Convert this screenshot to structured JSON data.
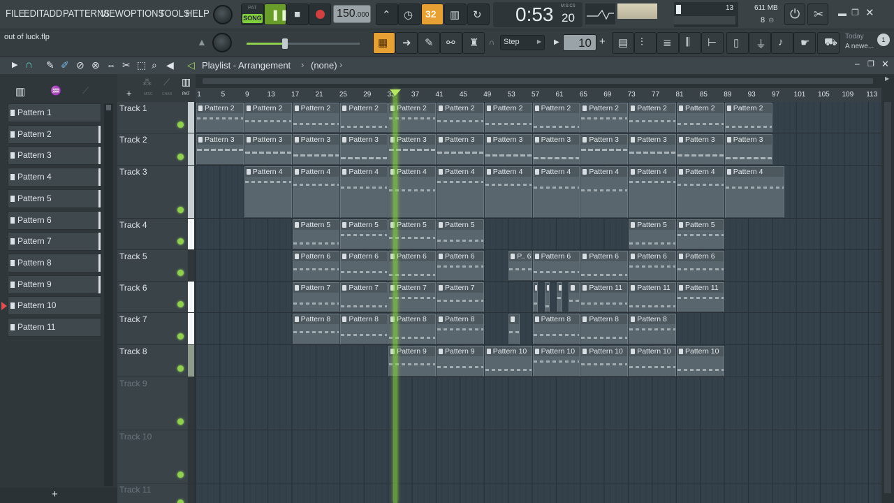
{
  "menu": [
    "FILE",
    "EDIT",
    "ADD",
    "PATTERNS",
    "VIEW",
    "OPTIONS",
    "TOOLS",
    "HELP"
  ],
  "transport": {
    "pat_label": "PAT",
    "song_label": "SONG",
    "tempo": "150",
    "tempo_dec": ".000",
    "time": "0:53",
    "time_sub": "20",
    "time_unit": "M:S:CS",
    "cpu_count": "13",
    "ram": "611 MB",
    "voices": "8",
    "step_label": "Step",
    "snap_value": "10",
    "snap_plus": "+",
    "snap_minus": "−",
    "pattern_num": "32"
  },
  "project": {
    "filename": "out of luck.flp"
  },
  "hint": {
    "date": "Today",
    "text": "A newe..."
  },
  "notification": {
    "count": "1"
  },
  "playlist": {
    "title": "Playlist - Arrangement",
    "pattern": "(none)",
    "sep": "›",
    "modes": [
      "MISC",
      "CHAN",
      "PAT"
    ]
  },
  "ruler": [
    "1",
    "5",
    "9",
    "13",
    "17",
    "21",
    "25",
    "29",
    "33",
    "37",
    "41",
    "45",
    "49",
    "53",
    "57",
    "61",
    "65",
    "69",
    "73",
    "77",
    "81",
    "85",
    "89",
    "93",
    "97",
    "101",
    "105",
    "109",
    "113"
  ],
  "patterns": [
    "Pattern 1",
    "Pattern 2",
    "Pattern 3",
    "Pattern 4",
    "Pattern 5",
    "Pattern 6",
    "Pattern 7",
    "Pattern 8",
    "Pattern 9",
    "Pattern 10",
    "Pattern 11"
  ],
  "tracks": [
    "Track 1",
    "Track 2",
    "Track 3",
    "Track 4",
    "Track 5",
    "Track 6",
    "Track 7",
    "Track 8",
    "Track 9",
    "Track 10",
    "Track 11"
  ],
  "browser_add": "+",
  "clips": [
    {
      "track": 0,
      "bar": 1,
      "len": 8,
      "label": "Pattern 2"
    },
    {
      "track": 0,
      "bar": 9,
      "len": 8,
      "label": "Pattern 2"
    },
    {
      "track": 0,
      "bar": 17,
      "len": 8,
      "label": "Pattern 2"
    },
    {
      "track": 0,
      "bar": 25,
      "len": 8,
      "label": "Pattern 2"
    },
    {
      "track": 0,
      "bar": 33,
      "len": 8,
      "label": "Pattern 2"
    },
    {
      "track": 0,
      "bar": 41,
      "len": 8,
      "label": "Pattern 2"
    },
    {
      "track": 0,
      "bar": 49,
      "len": 8,
      "label": "Pattern 2"
    },
    {
      "track": 0,
      "bar": 57,
      "len": 8,
      "label": "Pattern 2"
    },
    {
      "track": 0,
      "bar": 65,
      "len": 8,
      "label": "Pattern 2"
    },
    {
      "track": 0,
      "bar": 73,
      "len": 8,
      "label": "Pattern 2"
    },
    {
      "track": 0,
      "bar": 81,
      "len": 8,
      "label": "Pattern 2"
    },
    {
      "track": 0,
      "bar": 89,
      "len": 8,
      "label": "Pattern 2"
    },
    {
      "track": 1,
      "bar": 1,
      "len": 8,
      "label": "Pattern 3"
    },
    {
      "track": 1,
      "bar": 9,
      "len": 8,
      "label": "Pattern 3"
    },
    {
      "track": 1,
      "bar": 17,
      "len": 8,
      "label": "Pattern 3"
    },
    {
      "track": 1,
      "bar": 25,
      "len": 8,
      "label": "Pattern 3"
    },
    {
      "track": 1,
      "bar": 33,
      "len": 8,
      "label": "Pattern 3"
    },
    {
      "track": 1,
      "bar": 41,
      "len": 8,
      "label": "Pattern 3"
    },
    {
      "track": 1,
      "bar": 49,
      "len": 8,
      "label": "Pattern 3"
    },
    {
      "track": 1,
      "bar": 57,
      "len": 8,
      "label": "Pattern 3"
    },
    {
      "track": 1,
      "bar": 65,
      "len": 8,
      "label": "Pattern 3"
    },
    {
      "track": 1,
      "bar": 73,
      "len": 8,
      "label": "Pattern 3"
    },
    {
      "track": 1,
      "bar": 81,
      "len": 8,
      "label": "Pattern 3"
    },
    {
      "track": 1,
      "bar": 89,
      "len": 8,
      "label": "Pattern 3"
    },
    {
      "track": 2,
      "bar": 9,
      "len": 8,
      "label": "Pattern 4"
    },
    {
      "track": 2,
      "bar": 17,
      "len": 8,
      "label": "Pattern 4"
    },
    {
      "track": 2,
      "bar": 25,
      "len": 8,
      "label": "Pattern 4"
    },
    {
      "track": 2,
      "bar": 33,
      "len": 8,
      "label": "Pattern 4"
    },
    {
      "track": 2,
      "bar": 41,
      "len": 8,
      "label": "Pattern 4"
    },
    {
      "track": 2,
      "bar": 49,
      "len": 8,
      "label": "Pattern 4"
    },
    {
      "track": 2,
      "bar": 57,
      "len": 8,
      "label": "Pattern 4"
    },
    {
      "track": 2,
      "bar": 65,
      "len": 8,
      "label": "Pattern 4"
    },
    {
      "track": 2,
      "bar": 73,
      "len": 8,
      "label": "Pattern 4"
    },
    {
      "track": 2,
      "bar": 81,
      "len": 8,
      "label": "Pattern 4"
    },
    {
      "track": 2,
      "bar": 89,
      "len": 10,
      "label": "Pattern 4"
    },
    {
      "track": 3,
      "bar": 17,
      "len": 8,
      "label": "Pattern 5"
    },
    {
      "track": 3,
      "bar": 25,
      "len": 8,
      "label": "Pattern 5"
    },
    {
      "track": 3,
      "bar": 33,
      "len": 8,
      "label": "Pattern 5"
    },
    {
      "track": 3,
      "bar": 41,
      "len": 8,
      "label": "Pattern 5"
    },
    {
      "track": 3,
      "bar": 73,
      "len": 8,
      "label": "Pattern 5"
    },
    {
      "track": 3,
      "bar": 81,
      "len": 8,
      "label": "Pattern 5"
    },
    {
      "track": 4,
      "bar": 17,
      "len": 8,
      "label": "Pattern 6"
    },
    {
      "track": 4,
      "bar": 25,
      "len": 8,
      "label": "Pattern 6"
    },
    {
      "track": 4,
      "bar": 33,
      "len": 8,
      "label": "Pattern 6"
    },
    {
      "track": 4,
      "bar": 41,
      "len": 8,
      "label": "Pattern 6"
    },
    {
      "track": 4,
      "bar": 53,
      "len": 4,
      "label": "P.. 6"
    },
    {
      "track": 4,
      "bar": 57,
      "len": 8,
      "label": "Pattern 6"
    },
    {
      "track": 4,
      "bar": 65,
      "len": 8,
      "label": "Pattern 6"
    },
    {
      "track": 4,
      "bar": 73,
      "len": 8,
      "label": "Pattern 6"
    },
    {
      "track": 4,
      "bar": 81,
      "len": 8,
      "label": "Pattern 6"
    },
    {
      "track": 5,
      "bar": 17,
      "len": 8,
      "label": "Pattern 7"
    },
    {
      "track": 5,
      "bar": 25,
      "len": 8,
      "label": "Pattern 7"
    },
    {
      "track": 5,
      "bar": 33,
      "len": 8,
      "label": "Pattern 7"
    },
    {
      "track": 5,
      "bar": 41,
      "len": 8,
      "label": "Pattern 7"
    },
    {
      "track": 5,
      "bar": 57,
      "len": 1,
      "label": ""
    },
    {
      "track": 5,
      "bar": 59,
      "len": 1,
      "label": ""
    },
    {
      "track": 5,
      "bar": 61,
      "len": 1,
      "label": ""
    },
    {
      "track": 5,
      "bar": 63,
      "len": 2,
      "label": ""
    },
    {
      "track": 5,
      "bar": 65,
      "len": 8,
      "label": "Pattern 11"
    },
    {
      "track": 5,
      "bar": 73,
      "len": 8,
      "label": "Pattern 11"
    },
    {
      "track": 5,
      "bar": 81,
      "len": 8,
      "label": "Pattern 11"
    },
    {
      "track": 6,
      "bar": 17,
      "len": 8,
      "label": "Pattern 8"
    },
    {
      "track": 6,
      "bar": 25,
      "len": 8,
      "label": "Pattern 8"
    },
    {
      "track": 6,
      "bar": 33,
      "len": 8,
      "label": "Pattern 8"
    },
    {
      "track": 6,
      "bar": 41,
      "len": 8,
      "label": "Pattern 8"
    },
    {
      "track": 6,
      "bar": 53,
      "len": 2,
      "label": ""
    },
    {
      "track": 6,
      "bar": 57,
      "len": 8,
      "label": "Pattern 8"
    },
    {
      "track": 6,
      "bar": 65,
      "len": 8,
      "label": "Pattern 8"
    },
    {
      "track": 6,
      "bar": 73,
      "len": 8,
      "label": "Pattern 8"
    },
    {
      "track": 7,
      "bar": 33,
      "len": 8,
      "label": "Pattern 9"
    },
    {
      "track": 7,
      "bar": 41,
      "len": 8,
      "label": "Pattern 9"
    },
    {
      "track": 7,
      "bar": 49,
      "len": 8,
      "label": "Pattern 10"
    },
    {
      "track": 7,
      "bar": 57,
      "len": 8,
      "label": "Pattern 10"
    },
    {
      "track": 7,
      "bar": 65,
      "len": 8,
      "label": "Pattern 10"
    },
    {
      "track": 7,
      "bar": 73,
      "len": 8,
      "label": "Pattern 10"
    },
    {
      "track": 7,
      "bar": 81,
      "len": 8,
      "label": "Pattern 10"
    }
  ],
  "colors": {
    "accent": "#f0a030",
    "led": "#8fd14f",
    "playhead": "#8cdc3c",
    "record": "#d04040"
  }
}
